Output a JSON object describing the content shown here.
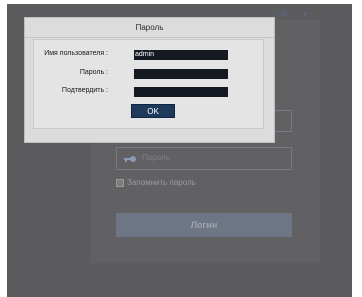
{
  "login_page": {
    "language_label": "ой",
    "caret": "▼",
    "password_placeholder": "Пароль",
    "remember_label": "Запомнить пароль",
    "login_button": "Логин"
  },
  "dialog": {
    "title": "Пароль",
    "username_label": "Имя пользователя :",
    "username_value": "admin",
    "password_label": "Пароль :",
    "password_value": "",
    "confirm_label": "Подтвердить :",
    "confirm_value": "",
    "ok_button": "OK"
  },
  "colors": {
    "overlay_bg": "#5c5c5e",
    "dialog_bg": "#dcdcdc",
    "field_bg": "#151a22",
    "ok_button_bg": "#1e3a5a"
  }
}
